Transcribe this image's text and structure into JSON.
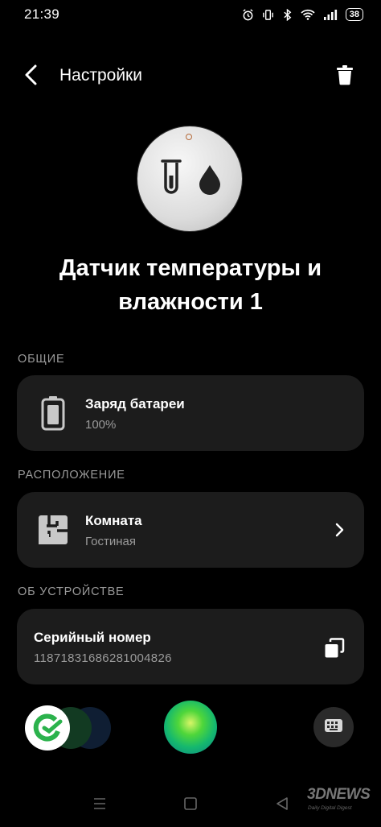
{
  "status_bar": {
    "time": "21:39",
    "battery": "38",
    "icons": [
      "alarm-icon",
      "vibrate-icon",
      "bluetooth-icon",
      "wifi-icon",
      "signal-icon",
      "battery-icon"
    ]
  },
  "header": {
    "title": "Настройки",
    "back_icon": "chevron-left-icon",
    "delete_icon": "trash-icon"
  },
  "device": {
    "name": "Датчик температуры и влажности 1",
    "image_icons": [
      "test-tube-icon",
      "droplet-icon"
    ]
  },
  "sections": {
    "general": {
      "label": "ОБЩИЕ",
      "battery": {
        "title": "Заряд батареи",
        "value": "100%",
        "icon": "battery-full-icon"
      }
    },
    "location": {
      "label": "РАСПОЛОЖЕНИЕ",
      "room": {
        "title": "Комната",
        "value": "Гостиная",
        "icon": "room-icon",
        "action_icon": "chevron-right-icon"
      }
    },
    "about": {
      "label": "ОБ УСТРОЙСТВЕ",
      "serial": {
        "title": "Серийный номер",
        "value": "11871831686281004826",
        "action_icon": "copy-icon"
      }
    }
  },
  "dock": {
    "apps": [
      "sber-app-icon",
      "voice-assistant-icon",
      "keyboard-icon"
    ]
  },
  "nav_bar": {
    "buttons": [
      "menu-icon",
      "home-icon",
      "back-icon"
    ]
  },
  "watermark": {
    "logo": "3DNEWS",
    "tagline": "Daily Digital Digest"
  },
  "colors": {
    "background": "#000000",
    "card": "#1c1c1c",
    "secondary_text": "#9a9a9a",
    "accent_green": "#4fd63a"
  }
}
